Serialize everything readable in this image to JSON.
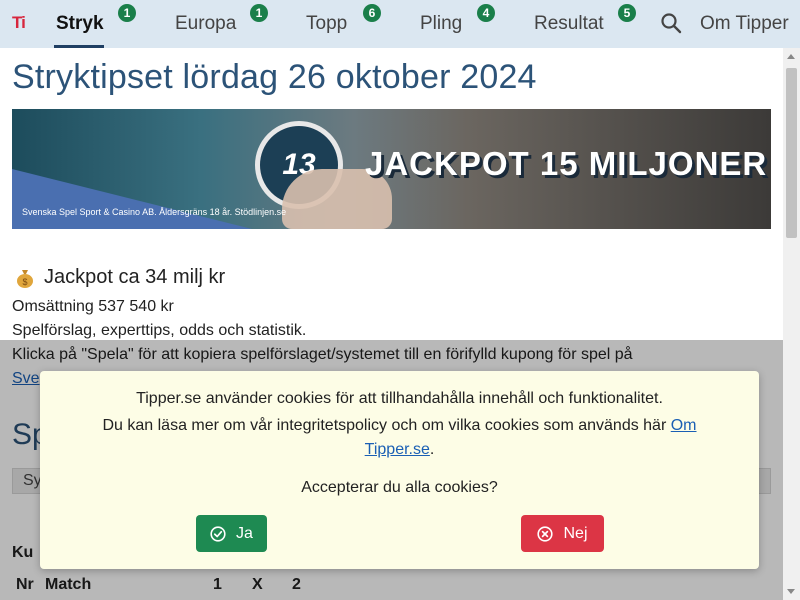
{
  "nav": {
    "logo": "Ti",
    "items": [
      {
        "label": "Stryk",
        "badge": "1"
      },
      {
        "label": "Europa",
        "badge": "1"
      },
      {
        "label": "Topp",
        "badge": "6"
      },
      {
        "label": "Pling",
        "badge": "4"
      },
      {
        "label": "Resultat",
        "badge": "5"
      }
    ],
    "about_label": "Om Tipper",
    "search_icon": "search-icon"
  },
  "main": {
    "title": "Stryktipset lördag 26 oktober 2024",
    "banner": {
      "number": "13",
      "headline": "JACKPOT 15 MILJONER",
      "disclaimer": "Svenska Spel Sport & Casino AB. Åldersgräns 18 år. Stödlinjen.se"
    },
    "jackpot_icon": "moneybag-icon",
    "jackpot_text": "Jackpot ca 34 milj kr",
    "turnover": "Omsättning 537 540 kr",
    "tagline": "Spelförslag, experttips, odds och statistik.",
    "instruction": "Klicka på \"Spela\" för att kopiera spelförslaget/systemet till en förifylld kupong för spel på",
    "instruction_link": "Sve",
    "section_heading": "Spe",
    "grey_bar_text": "Sy",
    "section_label": "Ku",
    "table_headers": [
      "Nr",
      "Match",
      "1",
      "X",
      "2"
    ]
  },
  "cookie": {
    "line1": "Tipper.se använder cookies för att tillhandahålla innehåll och funktionalitet.",
    "line2": "Du kan läsa mer om vår integritetspolicy och om vilka cookies som används här",
    "link": "Om Tipper.se",
    "line2_end": ".",
    "question": "Accepterar du alla cookies?",
    "yes_label": "Ja",
    "no_label": "Nej",
    "yes_color": "#1e8a52",
    "no_color": "#dc3545"
  }
}
